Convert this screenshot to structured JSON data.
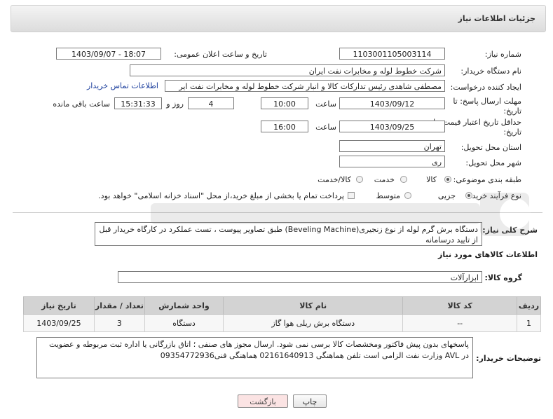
{
  "page": {
    "title": "جزئیات اطلاعات نیاز"
  },
  "fields": {
    "need_number_label": "شماره نیاز:",
    "need_number": "1103001105003114",
    "announce_label": "تاریخ و ساعت اعلان عمومی:",
    "announce_value": "1403/09/07 - 18:07",
    "buyer_label": "نام دستگاه خریدار:",
    "buyer_value": "شرکت خطوط لوله و مخابرات نفت ایران",
    "creator_label": "ایجاد کننده درخواست:",
    "creator_value": "مصطفی  شاهدی رئیس تدارکات کالا و انبار شرکت خطوط لوله و مخابرات نفت ایر",
    "contact_link": "اطلاعات تماس خریدار",
    "deadline_label_1": "مهلت ارسال پاسخ: تا",
    "deadline_label_2": "تاریخ:",
    "deadline_date": "1403/09/12",
    "time_label": "ساعت",
    "deadline_time": "10:00",
    "days_value": "4",
    "days_label": "روز و",
    "remaining_time": "15:31:33",
    "remaining_label": "ساعت باقی مانده",
    "validity_label_1": "حداقل تاریخ اعتبار قیمت: تا",
    "validity_label_2": "تاریخ:",
    "validity_date": "1403/09/25",
    "validity_time_label": "ساعت",
    "validity_time": "16:00",
    "province_label": "استان محل تحویل:",
    "province_value": "تهران",
    "city_label": "شهر محل تحویل:",
    "city_value": "ری",
    "category_label": "طبقه بندی موضوعی:",
    "category_options": [
      "کالا",
      "خدمت",
      "کالا/خدمت"
    ],
    "purchase_label": "نوع فرآیند خرید :",
    "purchase_options": [
      "جزیی",
      "متوسط"
    ],
    "payment_note": "پرداخت تمام یا بخشی از مبلغ خرید،از محل \"اسناد خزانه اسلامی\" خواهد بود.",
    "description_label": "شرح کلی نیاز:",
    "description_value": "دستگاه برش گرم لوله از نوع زنجیری(Beveling Machine) طبق تصاویر پیوست ، تست عملکرد در کارگاه خریدار قبل از تایید درسامانه",
    "goods_info_title": "اطلاعات کالاهای مورد نیاز",
    "goods_group_label": "گروه کالا:",
    "goods_group_value": "ابزارآلات"
  },
  "table": {
    "headers": [
      "ردیف",
      "کد کالا",
      "نام کالا",
      "واحد شمارش",
      "تعداد / مقدار",
      "تاریخ نیاز"
    ],
    "rows": [
      [
        "1",
        "--",
        "دستگاه برش ریلی هوا گاز",
        "دستگاه",
        "3",
        "1403/09/25"
      ]
    ]
  },
  "buyer_notes": {
    "label": "توضیحات خریدار:",
    "value": "پاسخهای بدون پیش فاکتور ومخشصات کالا برسی نمی شود. ارسال مجوز های صنفی ؛ اتاق بازرگانی یا اداره ثبت  مربوطه و عضویت در AVL وزارت نفت الزامی است تلفن هماهنگی  02161640913  هماهنگی فنی09354772936"
  },
  "buttons": {
    "print": "چاپ",
    "back": "بازگشت"
  },
  "colors": {
    "link": "#1a3d9c",
    "back_button_bg": "#fbe3e3",
    "header_gray": "#d3d3d3"
  }
}
